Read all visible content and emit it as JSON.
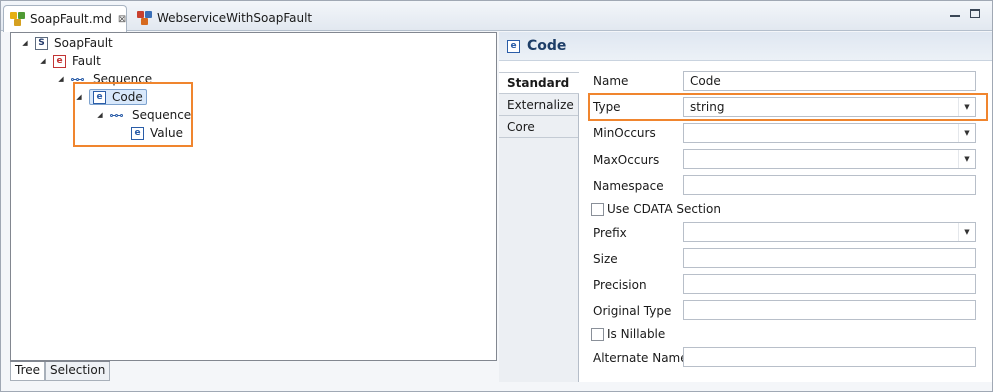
{
  "tabs": [
    {
      "label": "SoapFault.md",
      "close": "⊠"
    },
    {
      "label": "WebserviceWithSoapFault"
    }
  ],
  "tree": {
    "nodes": [
      {
        "label": "SoapFault",
        "icon": "S"
      },
      {
        "label": "Fault",
        "icon": "e"
      },
      {
        "label": "Sequence"
      },
      {
        "label": "Code",
        "icon": "e"
      },
      {
        "label": "Sequence"
      },
      {
        "label": "Value",
        "icon": "e"
      }
    ],
    "bottom_tabs": [
      "Tree",
      "Selection"
    ]
  },
  "properties": {
    "title": "Code",
    "title_icon": "e",
    "side_tabs": [
      "Standard",
      "Externalize",
      "Core"
    ],
    "fields": {
      "name": {
        "label": "Name",
        "value": "Code"
      },
      "type": {
        "label": "Type",
        "value": "string"
      },
      "min_occurs": {
        "label": "MinOccurs",
        "value": ""
      },
      "max_occurs": {
        "label": "MaxOccurs",
        "value": ""
      },
      "namespace": {
        "label": "Namespace",
        "value": ""
      },
      "use_cdata": {
        "label": "Use CDATA Section",
        "checked": false
      },
      "prefix": {
        "label": "Prefix",
        "value": ""
      },
      "size": {
        "label": "Size",
        "value": ""
      },
      "precision": {
        "label": "Precision",
        "value": ""
      },
      "original_type": {
        "label": "Original Type",
        "value": ""
      },
      "is_nillable": {
        "label": "Is Nillable",
        "checked": false
      },
      "alternate_name": {
        "label": "Alternate Name",
        "value": ""
      }
    }
  },
  "colors": {
    "highlight": "#f0852e",
    "selection_bg": "#d8e8fb",
    "element_icon_red": "#c23434",
    "element_icon_blue": "#2a5da8"
  }
}
